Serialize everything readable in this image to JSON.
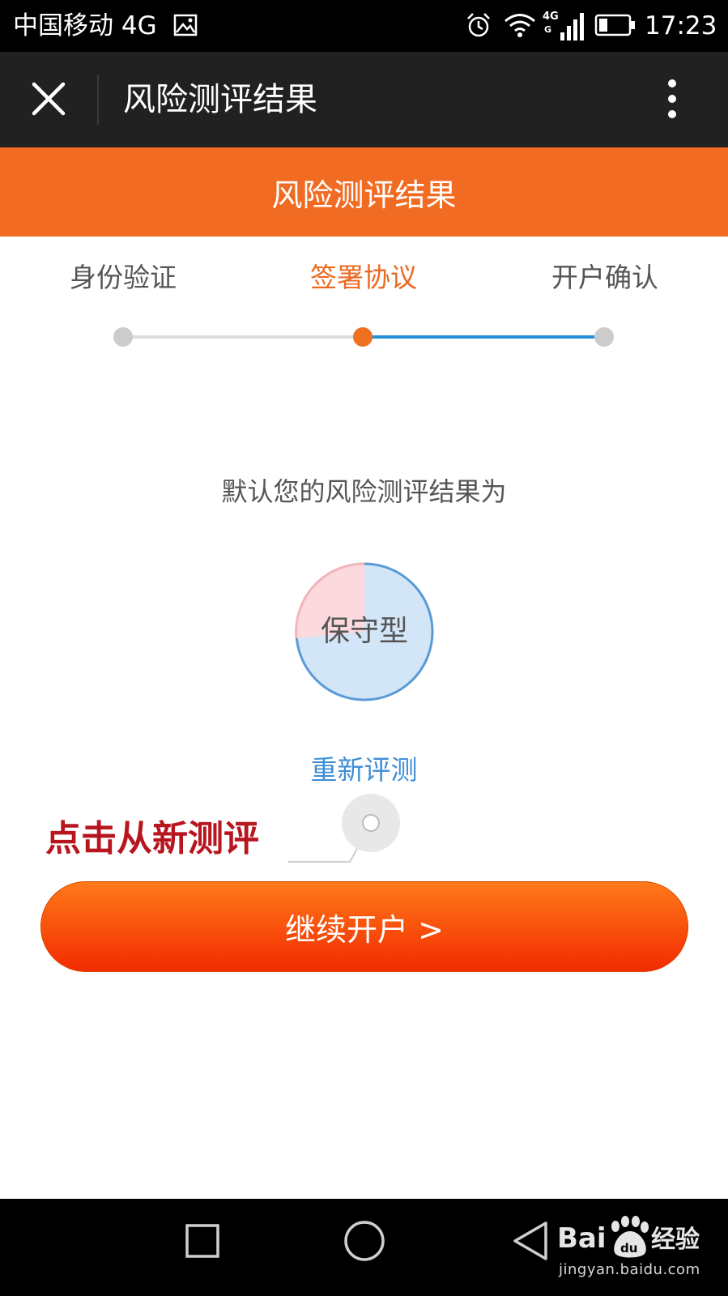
{
  "status_bar": {
    "carrier": "中国移动 4G",
    "time": "17:23",
    "icons": [
      "image-icon",
      "alarm-icon",
      "wifi-icon",
      "signal-4g-icon",
      "battery-icon"
    ]
  },
  "title_bar": {
    "title": "风险测评结果",
    "close_icon": "close-icon",
    "more_icon": "more-vertical-icon"
  },
  "header": {
    "title": "风险测评结果",
    "color": "#f26b22"
  },
  "steps": [
    {
      "label": "身份验证",
      "state": "done"
    },
    {
      "label": "签署协议",
      "state": "active"
    },
    {
      "label": "开户确认",
      "state": "pending"
    }
  ],
  "result": {
    "caption": "默认您的风险测评结果为",
    "type": "保守型",
    "retest_label": "重新评测"
  },
  "annotation": {
    "text": "点击从新测评"
  },
  "continue_button": {
    "label": "继续开户 >"
  },
  "nav_bar": {
    "icons": [
      "recent-apps-icon",
      "home-icon",
      "back-icon"
    ]
  },
  "watermark": {
    "url": "jingyan.baidu.com"
  },
  "colors": {
    "accent_orange": "#f26b22",
    "link_blue": "#3e8ed6",
    "progress_blue": "#2491d9",
    "annotation_red": "#b8161f"
  }
}
